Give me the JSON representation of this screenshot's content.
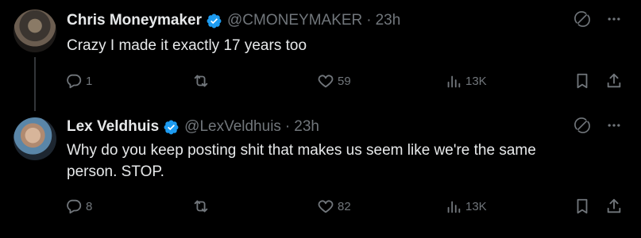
{
  "tweets": [
    {
      "name": "Chris Moneymaker",
      "handle": "@CMONEYMAKER",
      "separator": "·",
      "time": "23h",
      "text": "Crazy I made it exactly 17 years too",
      "replies": "1",
      "retweets": "",
      "likes": "59",
      "views": "13K"
    },
    {
      "name": "Lex Veldhuis",
      "handle": "@LexVeldhuis",
      "separator": "·",
      "time": "23h",
      "text": "Why do you keep posting shit that makes us seem like we're the same person. STOP.",
      "replies": "8",
      "retweets": "",
      "likes": "82",
      "views": "13K"
    }
  ],
  "colors": {
    "background": "#000000",
    "text": "#e7e9ea",
    "muted": "#71767b",
    "verified": "#1d9bf0"
  },
  "icons": [
    "verified-badge-icon",
    "grok-icon",
    "more-icon",
    "reply-icon",
    "retweet-icon",
    "like-icon",
    "views-icon",
    "bookmark-icon",
    "share-icon"
  ]
}
